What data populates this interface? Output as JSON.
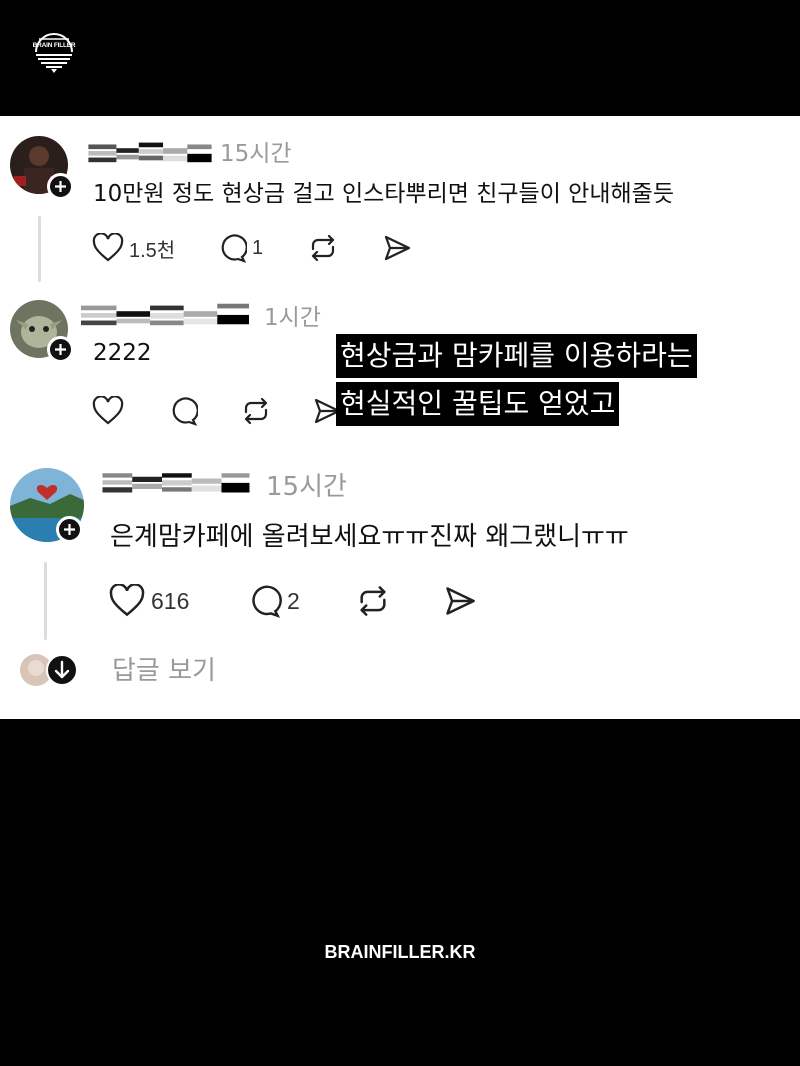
{
  "brand": {
    "logo_text": "BRAIN FILLER",
    "footer_text": "BRAINFILLER.KR"
  },
  "comments": [
    {
      "time": "15시간",
      "text": "10만원 정도 현상금 걸고 인스타뿌리면 친구들이 안내해줄듯",
      "likes": "1.5천",
      "replies": "1"
    },
    {
      "time": "1시간",
      "text": "2222",
      "likes": "",
      "replies": ""
    },
    {
      "time": "15시간",
      "text": "은계맘카페에 올려보세요ㅠㅠ진짜 왜그랬니ㅠㅠ",
      "likes": "616",
      "replies": "2"
    }
  ],
  "caption": {
    "line1": "현상금과 맘카페를 이용하라는",
    "line2": "현실적인 꿀팁도 얻었고"
  },
  "view_replies_label": "답글 보기",
  "icons": [
    "heart-icon",
    "comment-icon",
    "repost-icon",
    "share-icon",
    "plus-icon",
    "arrow-down-icon"
  ]
}
